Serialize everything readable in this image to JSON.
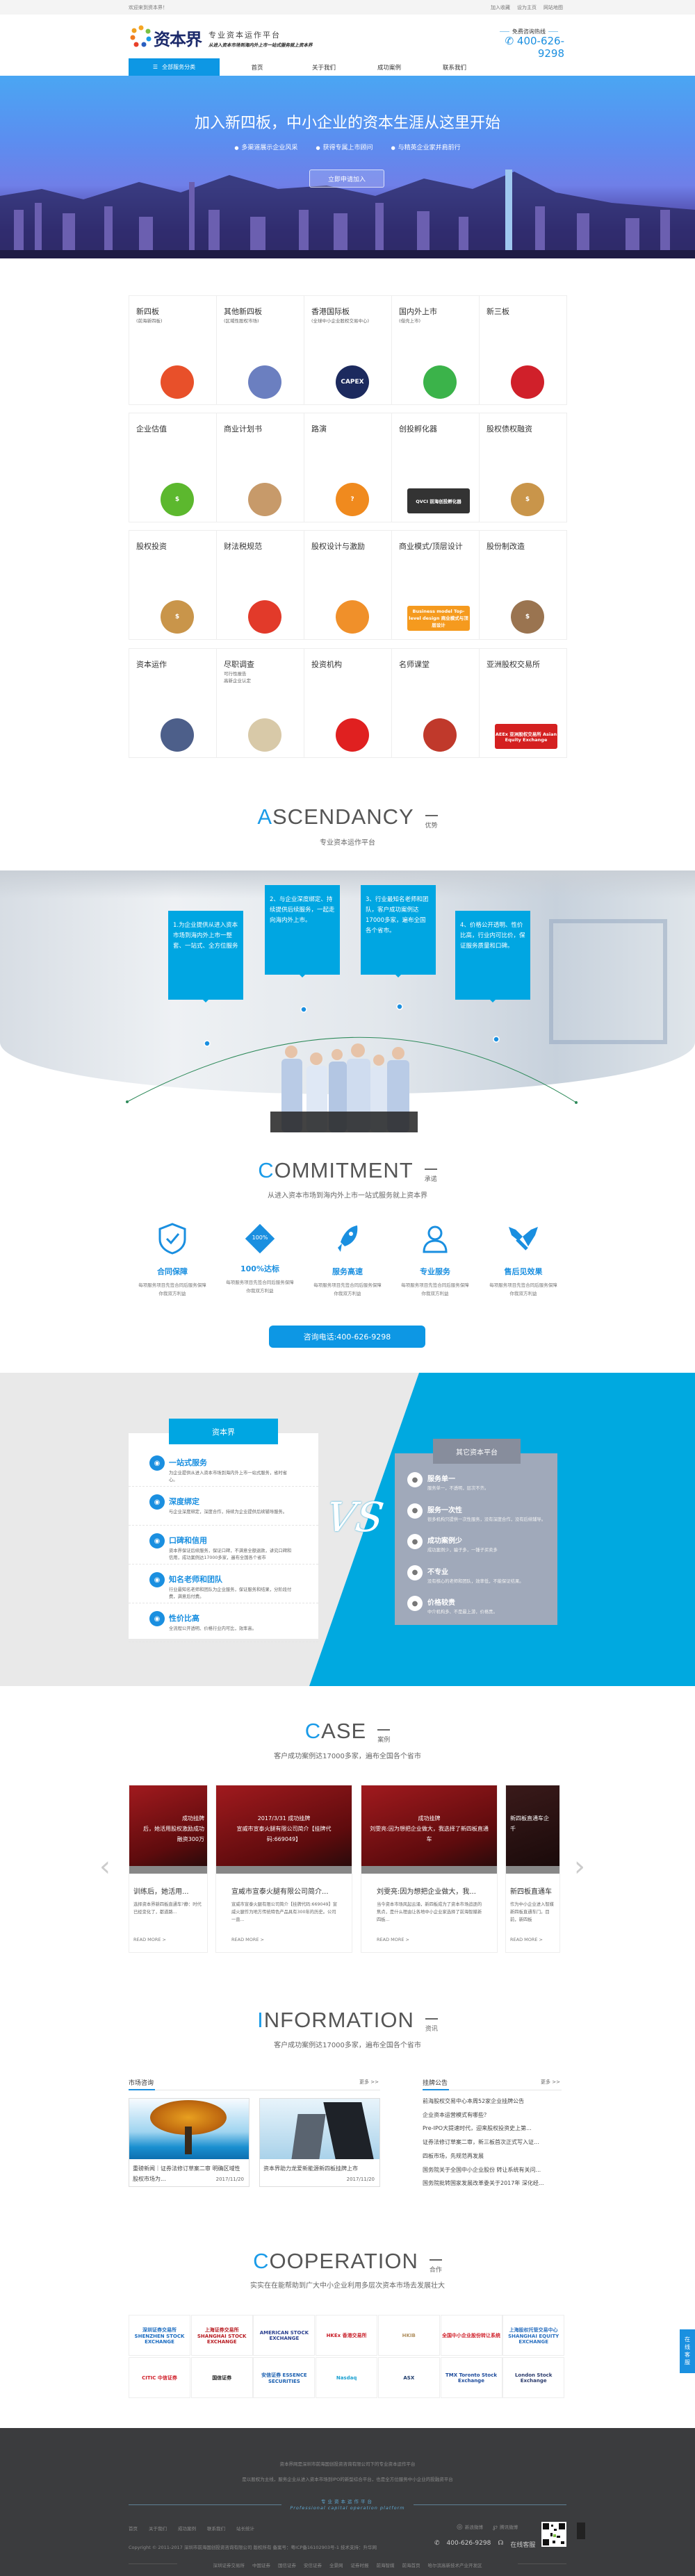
{
  "topbar": {
    "welcome": "欢迎来到资本界！",
    "links": [
      "加入收藏",
      "设为主页",
      "网站地图"
    ]
  },
  "logo": {
    "name": "资本界",
    "slogan": "专业资本运作平台",
    "tagline": "从进入资本市场到海内外上市一站式服务就上资本界"
  },
  "hotline": {
    "label": "免费咨询热线",
    "number": "400-626-9298"
  },
  "nav": {
    "category": "全部服务分类",
    "items": [
      {
        "label": "首页"
      },
      {
        "label": "关于我们"
      },
      {
        "label": "成功案例"
      },
      {
        "label": "联系我们"
      }
    ]
  },
  "banner": {
    "title": "加入新四板，中小企业的资本生涯从这里开始",
    "bullets": [
      "多渠道展示企业风采",
      "获得专属上市顾问",
      "与精英企业家并肩前行"
    ],
    "button": "立即申请加入"
  },
  "services": [
    {
      "title": "新四板",
      "sub": "(前海新四板)",
      "icon": "maple-ring-logo",
      "color": "#e8502a",
      "mark": ""
    },
    {
      "title": "其他新四板",
      "sub": "(区域性股权市场)",
      "icon": "city-skyline",
      "color": "#6b7fc0",
      "mark": ""
    },
    {
      "title": "香港国际板",
      "sub": "(全球中小企业股权交易中心)",
      "icon": "capex-logo",
      "color": "#1c2a5e",
      "mark": "CAPEX"
    },
    {
      "title": "国内外上市",
      "sub": "(借壳上市)",
      "icon": "growth-chart",
      "color": "#3bb34a",
      "mark": ""
    },
    {
      "title": "新三板",
      "sub": "",
      "icon": "red-gem-logo",
      "color": "#d0202a",
      "mark": ""
    },
    {
      "title": "企业估值",
      "sub": "",
      "icon": "dollar-coins",
      "color": "#5cb82e",
      "mark": "$"
    },
    {
      "title": "商业计划书",
      "sub": "",
      "icon": "pen-scroll",
      "color": "#c79a6a",
      "mark": ""
    },
    {
      "title": "路演",
      "sub": "",
      "icon": "gold-question",
      "color": "#f08a1e",
      "mark": "?"
    },
    {
      "title": "创投孵化器",
      "sub": "",
      "icon": "qvci-logo",
      "color": "#333333",
      "mark": "QVCI 前海创投孵化器"
    },
    {
      "title": "股权债权融资",
      "sub": "",
      "icon": "money-bag",
      "color": "#c9954a",
      "mark": "$"
    },
    {
      "title": "股权投资",
      "sub": "",
      "icon": "money-bag-coins",
      "color": "#c9954a",
      "mark": "$"
    },
    {
      "title": "财法税规范",
      "sub": "",
      "icon": "bar-chart",
      "color": "#e23a2a",
      "mark": ""
    },
    {
      "title": "股权设计与激励",
      "sub": "",
      "icon": "pie-chart",
      "color": "#f0902a",
      "mark": ""
    },
    {
      "title": "商业模式/顶层设计",
      "sub": "",
      "icon": "business-model-banner",
      "color": "#f59a1e",
      "mark": "Business model Top-level design 商业模式与顶层设计"
    },
    {
      "title": "股份制改造",
      "sub": "",
      "icon": "money-bag-arrow",
      "color": "#9a7450",
      "mark": "$"
    },
    {
      "title": "资本运作",
      "sub": "",
      "icon": "globe-coins",
      "color": "#4d5f8a",
      "mark": ""
    },
    {
      "title": "尽职调查",
      "sub": "可行性报告\n高新企业认定",
      "icon": "clipboard",
      "color": "#d8c9a8",
      "mark": ""
    },
    {
      "title": "投资机构",
      "sub": "",
      "icon": "piggy-bank",
      "color": "#e02020",
      "mark": ""
    },
    {
      "title": "名师课堂",
      "sub": "",
      "icon": "books",
      "color": "#c0392b",
      "mark": ""
    },
    {
      "title": "亚洲股权交易所",
      "sub": "",
      "icon": "aeex-logo",
      "color": "#d42020",
      "mark": "AEEx 亚洲股权交易所 Asian Equity Exchange"
    }
  ],
  "ascendancy": {
    "first": "A",
    "rest": "SCENDANCY",
    "cn": "优势",
    "subtitle": "专业资本运作平台",
    "points": [
      "1.为企业提供从进入资本市场到海内外上市一整套、一站式、全方位服务",
      "2、与企业深度绑定、持续提供后续服务，一起走向海内外上市。",
      "3、行业最知名老师和团队，客户成功案例达17000多家，遍布全国各个省市。",
      "4、价格公开透明、性价比高，行业内可比价，保证服务质量和口碑。"
    ]
  },
  "commitment": {
    "first": "C",
    "rest": "OMMITMENT",
    "cn": "承诺",
    "subtitle": "从进入资本市场到海内外上市一站式服务就上资本界",
    "items": [
      {
        "title": "合同保障",
        "desc": "每项服务项目先签合同后服务保障你我双方利益",
        "icon": "shield-check-icon"
      },
      {
        "title": "100%达标",
        "desc": "每项服务项目先签合同后服务保障你我双方利益",
        "icon": "diamond-100-icon",
        "badge": "100%"
      },
      {
        "title": "服务高速",
        "desc": "每项服务项目先签合同后服务保障你我双方利益",
        "icon": "rocket-icon"
      },
      {
        "title": "专业服务",
        "desc": "每项服务项目先签合同后服务保障你我双方利益",
        "icon": "users-icon"
      },
      {
        "title": "售后见效果",
        "desc": "每项服务项目先签合同后服务保障你我双方利益",
        "icon": "handshake-icon"
      }
    ],
    "button": "咨询电话:400-626-9298"
  },
  "vs": {
    "label": "VS",
    "left": {
      "title": "资本界",
      "items": [
        {
          "title": "一站式服务",
          "desc": "为企业提供从进入资本市场到海内外上市一站式服务，省时省心。",
          "icon": "signal-icon"
        },
        {
          "title": "深度绑定",
          "desc": "与企业深度绑定，深度合作，持续为企业提供后续辅导服务。",
          "icon": "link-icon"
        },
        {
          "title": "口碑和信用",
          "desc": "资本界保证后续服务，保证口碑，不满意全额退款，讲究口碑和信用，成功案例达17000多家，遍布全国各个省市",
          "icon": "smile-icon"
        },
        {
          "title": "知名老师和团队",
          "desc": "行业最知名老师和团队为企业服务，保证服务和结果，分阶段付费，满意后付费。",
          "icon": "team-icon"
        },
        {
          "title": "性价比高",
          "desc": "全流程公开透明、价格行业内可比，效率高。",
          "icon": "ticket-icon"
        }
      ]
    },
    "right": {
      "title": "其它资本平台",
      "items": [
        {
          "title": "服务单一",
          "desc": "服务单一，不透明，层次不齐。",
          "icon": "split-arrow-icon"
        },
        {
          "title": "服务一次性",
          "desc": "很多机构只提供一次性服务，没有深度合作，没有后续辅导。",
          "icon": "one-time-icon"
        },
        {
          "title": "成功案例少",
          "desc": "成功案例少，骗子多，一锤子买卖多",
          "icon": "less-than-icon"
        },
        {
          "title": "不专业",
          "desc": "没有核心的老师和团队，效率低，不能保证结果。",
          "icon": "thumbs-down-icon"
        },
        {
          "title": "价格较贵",
          "desc": "中介机构多、不是最上游，价格贵。",
          "icon": "crowd-icon"
        }
      ]
    }
  },
  "case": {
    "first": "C",
    "rest": "ASE",
    "cn": "案例",
    "subtitle": "客户成功案例达17000多家，遍布全国各个省市",
    "read_more": "READ MORE >",
    "cards": [
      {
        "overlay": "成功挂牌\n后，她活用股权激励成功\n融资300万",
        "title": "训练后，她活用...",
        "desc": "选择资本界新四板直通车?静：时代已经变化了，都道路..."
      },
      {
        "overlay": "2017/3/31 成功挂牌\n宣威市宣泰火腿有限公司简介【挂牌代码:669049】",
        "title": "宣威市宣泰火腿有限公司简介...",
        "desc": "宣威市宣泰火腿有限公司简介【挂牌代码:669049】宣威火腿作为地方传统特色产品具有300年的历史。公司一直..."
      },
      {
        "overlay": "成功挂牌\n刘雯亮:因为想把企业做大，我选择了新四板直通车",
        "title": "刘雯亮:因为想把企业做大，我...",
        "desc": "当今资本市场风起云涌，新四板成为了资本市场追逐的焦点，是什么理由让各地中小企业家选择了前海智媒新四板..."
      },
      {
        "overlay": "新四板直通车企\n千",
        "title": "新四板直通车",
        "desc": "作为中小企业进入智媒新四板直通车门。目前，新四板"
      }
    ]
  },
  "information": {
    "first": "I",
    "rest": "NFORMATION",
    "cn": "资讯",
    "subtitle": "客户成功案例达17000多家，遍布全国各个省市",
    "left": {
      "tab": "市场咨询",
      "more": "更多 >>",
      "news": [
        {
          "title": "重磅新闻｜证券法修订草案二审 明确区域性股权市场为...",
          "date": "2017/11/20"
        },
        {
          "title": "资本界助力龙爱新能源新四板挂牌上市",
          "date": "2017/11/20"
        }
      ]
    },
    "right": {
      "tab": "挂牌公告",
      "more": "更多 >>",
      "items": [
        "前海股权交易中心本周52家企业挂牌公告",
        "企业资本运营模式有哪些？",
        "Pre-IPO大提速时代，迎来股权投资史上第...",
        "证券法修订草案二审，新三板首次正式写入证...",
        "四板市场，先规范再发展",
        "国务院关于全国中小企业股份 转让系统有关问...",
        "国务院批转国家发展改革委关于2017年 深化经..."
      ]
    }
  },
  "cooperation": {
    "first": "C",
    "rest": "OOPERATION",
    "cn": "合作",
    "subtitle": "实实在在能帮助到广大中小企业利用多层次资本市场去发展壮大",
    "partners": [
      {
        "name": "深圳证券交易所 SHENZHEN STOCK EXCHANGE",
        "color": "#1a6bc0"
      },
      {
        "name": "上海证券交易所 SHANGHAI STOCK EXCHANGE",
        "color": "#b81c22"
      },
      {
        "name": "AMERICAN STOCK EXCHANGE",
        "color": "#2a3f8f"
      },
      {
        "name": "HKEx 香港交易所",
        "color": "#c8202a"
      },
      {
        "name": "HKIB",
        "color": "#b09060"
      },
      {
        "name": "全国中小企业股份转让系统",
        "color": "#d0202a"
      },
      {
        "name": "上海股权托管交易中心 SHANGHAI EQUITY EXCHANGE",
        "color": "#2a70c0"
      },
      {
        "name": "CITIC 中信证券",
        "color": "#d0202a"
      },
      {
        "name": "国信证券",
        "color": "#222222"
      },
      {
        "name": "安信证券 ESSENCE SECURITIES",
        "color": "#1a5fb0"
      },
      {
        "name": "Nasdaq",
        "color": "#1aa0d0"
      },
      {
        "name": "ASX",
        "color": "#1c3a6b"
      },
      {
        "name": "TMX Toronto Stock Exchange",
        "color": "#1c4a9b"
      },
      {
        "name": "London Stock Exchange",
        "color": "#2a3a6b"
      }
    ]
  },
  "footer": {
    "line1": "资本界网是深圳市前海国创投资咨询有限公司下的专业资本运作平台",
    "line2": "是以股权为主线，服务企业从进入资本市场到IPO的新型综合平台，也是全方位服务中小企业的投融资平台",
    "platform_cn": "专业资本运作平台",
    "platform_en": "Professional capital operation platform",
    "nav": [
      "首页",
      "关于我们",
      "成功案例",
      "联系我们",
      "站长统计"
    ],
    "copyright": "Copyright © 2011-2017 深圳市前海国创投资咨询有限公司 版权所有 备案号：粤ICP备16102903号-1 技术支持：升华网",
    "social": [
      "新浪微博",
      "腾讯微博"
    ],
    "phone": "400-626-9298",
    "online": "在线客服",
    "links": [
      "深圳证券交易所",
      "中国证券",
      "国信证券",
      "安信证券",
      "全景网",
      "证券时报",
      "前海智媒",
      "前海首页",
      "哈尔滨高新技术产业开发区"
    ]
  },
  "side_tab": "在线客服",
  "colors": {
    "brand_blue": "#0d97e4",
    "box_blue": "#00a6e2",
    "vs_gray": "#a0a9ba",
    "footer_bg": "#3b3c3e"
  }
}
